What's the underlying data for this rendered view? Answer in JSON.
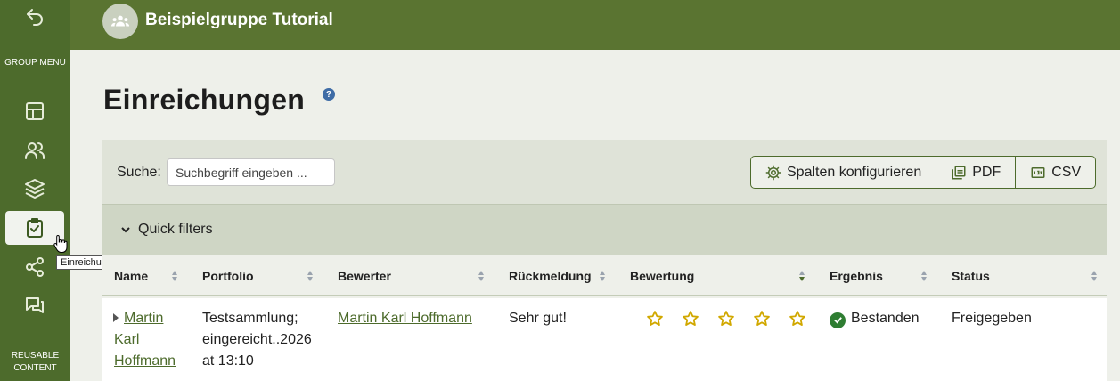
{
  "sidebar": {
    "group_menu_label": "GROUP MENU",
    "reusable_content_label": "REUSABLE CONTENT",
    "tooltip": "Einreichungen",
    "icons": [
      "back-icon",
      "dashboard-icon",
      "members-icon",
      "layers-icon",
      "submissions-icon",
      "share-icon",
      "forum-icon"
    ]
  },
  "header": {
    "group_title": "Beispielgruppe Tutorial"
  },
  "page": {
    "title": "Einreichungen",
    "help": "?"
  },
  "toolbar": {
    "search_label": "Suche:",
    "search_placeholder": "Suchbegriff eingeben ...",
    "configure_columns": "Spalten konfigurieren",
    "pdf": "PDF",
    "csv": "CSV"
  },
  "quick_filters": {
    "label": "Quick filters"
  },
  "table": {
    "columns": [
      "Name",
      "Portfolio",
      "Bewerter",
      "Rückmeldung",
      "Bewertung",
      "Ergebnis",
      "Status"
    ],
    "rows": [
      {
        "name_line1": "Martin",
        "name_line2": "Karl",
        "name_line3": "Hoffmann",
        "portfolio_line1": "Testsammlung;",
        "portfolio_line2": "eingereicht..2026",
        "portfolio_line3": "at 13:10",
        "bewerter": "Martin Karl Hoffmann",
        "rueckmeldung": "Sehr gut!",
        "bewertung_stars": 5,
        "ergebnis": "Bestanden",
        "status": "Freigegeben"
      }
    ]
  },
  "colors": {
    "sidebar": "#4d6b2c",
    "header": "#5a7431",
    "accent": "#4d6b2c",
    "star": "#d1a800",
    "success": "#2e7d32"
  }
}
